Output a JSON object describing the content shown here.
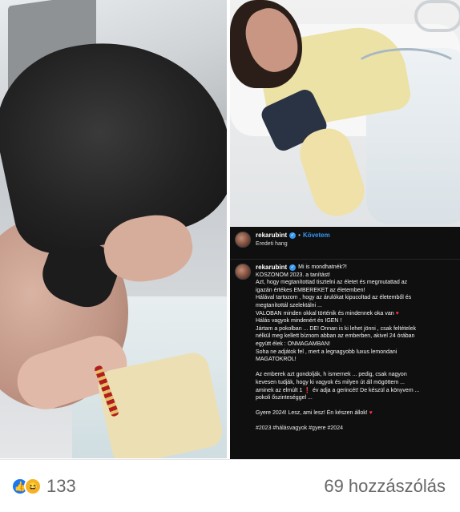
{
  "post": {
    "username": "rekarubint",
    "follow_label": "Követem",
    "separator": "•",
    "audio_label": "Eredeti hang",
    "caption": {
      "username": "rekarubint",
      "lines": [
        "Mi is mondhatnék?!",
        "KÖSZÖNÖM 2023. a tanítást!",
        "Azt, hogy megtanítottad tisztelni az életet és megmutattad az",
        "igazán értékes EMBEREKET az életemben!",
        "Hálával tartozom , hogy az árulókat kipucoltad az életemből és",
        "megtanítottál szelektálni ...",
        "VALÓBAN minden okkal történik és mindennek oka van",
        "Hálás vagyok mindenért és IGEN !",
        "Jártam a pokolban ... DE! Onnan is ki lehet jönni , csak feltételek",
        "nélkül meg kellett bíznom abban az emberben, akivel 24 órában",
        "együtt élek : ÖNMAGAMBAN!",
        "Soha ne adjátok fel , mert a legnagyobb luxus lemondani",
        "MAGATOKRÓL!",
        "",
        "Az emberek azt gondolják, h ismernek ... pedig, csak nagyon",
        "kevesen tudják, hogy ki vagyok és milyen út áll mögöttem ...",
        "aminek az elmúlt 1",
        "év adja a gerincét! De készül a könyvem ...",
        "pokoli őszinteséggel ...",
        "",
        "Gyere 2024! Lesz, ami lesz! Én készen állok!",
        "",
        "#2023 #hálásvagyok #gyere #2024"
      ]
    }
  },
  "reactions": {
    "icons": [
      "like-icon",
      "haha-icon"
    ],
    "count": "133",
    "comments_label": "69 hozzászólás"
  },
  "colors": {
    "instagram_bg": "#0f0f0f",
    "follow_blue": "#3797f0",
    "like_blue": "#1877f2",
    "heart_red": "#ff3040"
  }
}
